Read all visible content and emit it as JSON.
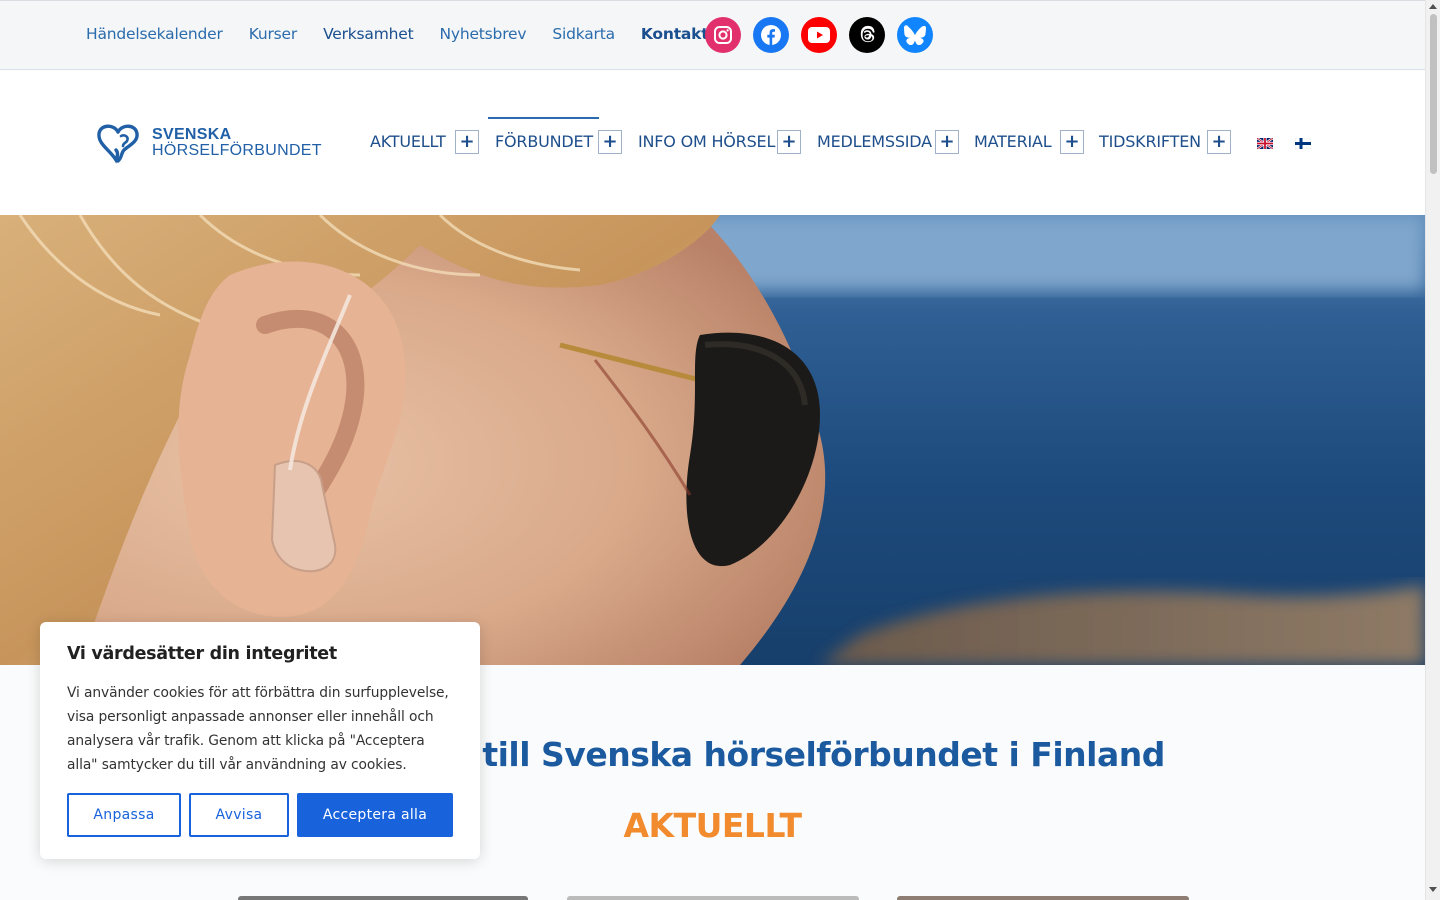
{
  "topbar": {
    "links": [
      "Händelsekalender",
      "Kurser",
      "Verksamhet",
      "Nyhetsbrev",
      "Sidkarta",
      "Kontakt"
    ],
    "socials": [
      {
        "name": "instagram-icon",
        "color": "#e1306c"
      },
      {
        "name": "facebook-icon",
        "color": "#1877f2"
      },
      {
        "name": "youtube-icon",
        "color": "#ff0000"
      },
      {
        "name": "threads-icon",
        "color": "#000000"
      },
      {
        "name": "bluesky-icon",
        "color": "#1185fe"
      }
    ]
  },
  "logo": {
    "line1": "SVENSKA",
    "line2": "HÖRSELFÖRBUNDET"
  },
  "nav": {
    "items": [
      "AKTUELLT",
      "FÖRBUNDET",
      "INFO OM HÖRSEL",
      "MEDLEMSSIDA",
      "MATERIAL",
      "TIDSKRIFTEN"
    ],
    "active": "FÖRBUNDET",
    "expand_symbol": "+",
    "languages": [
      "english-flag-icon",
      "finnish-flag-icon"
    ]
  },
  "main": {
    "headline": "Välkommen till Svenska hörselförbundet i Finland",
    "section_title": "AKTUELLT"
  },
  "cookie": {
    "title": "Vi värdesätter din integritet",
    "text": "Vi använder cookies för att förbättra din surfupplevelse, visa personligt anpassade annonser eller innehåll och analysera vår trafik. Genom att klicka på \"Acceptera alla\" samtycker du till vår användning av cookies.",
    "customize_label": "Anpassa",
    "reject_label": "Avvisa",
    "accept_label": "Acceptera alla"
  },
  "colors": {
    "brand_blue": "#1c5aa0",
    "accent_orange": "#f18b2e",
    "button_blue": "#1863dc"
  }
}
